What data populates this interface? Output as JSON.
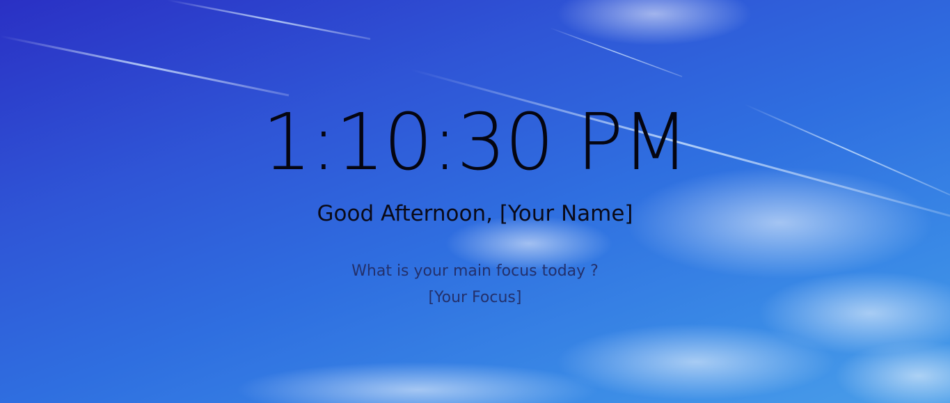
{
  "clock": {
    "time": "1:10:30 PM"
  },
  "greeting": {
    "text": "Good Afternoon, [Your Name]"
  },
  "focus": {
    "question": "What is your main focus today ?",
    "value": "[Your Focus]"
  },
  "background": {
    "description_icon": "sky-photo",
    "colors": [
      "#2a30c4",
      "#2f6fe0",
      "#4a9ee9"
    ]
  }
}
